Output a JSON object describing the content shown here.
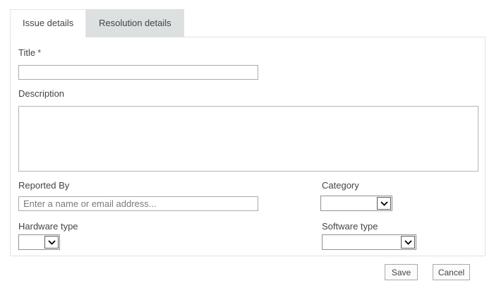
{
  "tabs": [
    {
      "label": "Issue details",
      "active": true
    },
    {
      "label": "Resolution details",
      "active": false
    }
  ],
  "form": {
    "title": {
      "label": "Title",
      "required_marker": "*",
      "value": ""
    },
    "description": {
      "label": "Description",
      "value": ""
    },
    "reported_by": {
      "label": "Reported By",
      "placeholder": "Enter a name or email address...",
      "value": ""
    },
    "category": {
      "label": "Category",
      "selected_value": ""
    },
    "hardware_type": {
      "label": "Hardware type",
      "selected_value": ""
    },
    "software_type": {
      "label": "Software type",
      "selected_value": ""
    }
  },
  "actions": {
    "save": "Save",
    "cancel": "Cancel"
  },
  "colors": {
    "tab_inactive_bg": "#dce0e0",
    "panel_border": "#e2e2e2",
    "input_border": "#ababab",
    "label_text": "#444444"
  }
}
